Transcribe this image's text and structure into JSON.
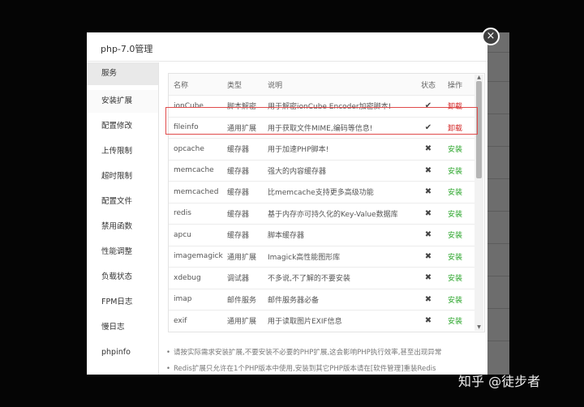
{
  "modal": {
    "title": "php-7.0管理",
    "close_glyph": "×"
  },
  "sidebar": {
    "items": [
      {
        "label": "服务"
      },
      {
        "label": "安装扩展"
      },
      {
        "label": "配置修改"
      },
      {
        "label": "上传限制"
      },
      {
        "label": "超时限制"
      },
      {
        "label": "配置文件"
      },
      {
        "label": "禁用函数"
      },
      {
        "label": "性能调整"
      },
      {
        "label": "负载状态"
      },
      {
        "label": "FPM日志"
      },
      {
        "label": "慢日志"
      },
      {
        "label": "phpinfo"
      }
    ]
  },
  "table": {
    "headers": [
      "名称",
      "类型",
      "说明",
      "状态",
      "操作"
    ],
    "rows": [
      {
        "name": "ionCube",
        "type": "脚本解密",
        "desc": "用于解密ionCube Encoder加密脚本!",
        "status": "✔",
        "op": "卸载",
        "installed": true
      },
      {
        "name": "fileinfo",
        "type": "通用扩展",
        "desc": "用于获取文件MIME,编码等信息!",
        "status": "✔",
        "op": "卸载",
        "installed": true
      },
      {
        "name": "opcache",
        "type": "缓存器",
        "desc": "用于加速PHP脚本!",
        "status": "✖",
        "op": "安装",
        "installed": false
      },
      {
        "name": "memcache",
        "type": "缓存器",
        "desc": "强大的内容缓存器",
        "status": "✖",
        "op": "安装",
        "installed": false
      },
      {
        "name": "memcached",
        "type": "缓存器",
        "desc": "比memcache支持更多高级功能",
        "status": "✖",
        "op": "安装",
        "installed": false
      },
      {
        "name": "redis",
        "type": "缓存器",
        "desc": "基于内存亦可持久化的Key-Value数据库",
        "status": "✖",
        "op": "安装",
        "installed": false
      },
      {
        "name": "apcu",
        "type": "缓存器",
        "desc": "脚本缓存器",
        "status": "✖",
        "op": "安装",
        "installed": false
      },
      {
        "name": "imagemagick",
        "type": "通用扩展",
        "desc": "Imagick高性能图形库",
        "status": "✖",
        "op": "安装",
        "installed": false
      },
      {
        "name": "xdebug",
        "type": "调试器",
        "desc": "不多说,不了解的不要安装",
        "status": "✖",
        "op": "安装",
        "installed": false
      },
      {
        "name": "imap",
        "type": "邮件服务",
        "desc": "邮件服务器必备",
        "status": "✖",
        "op": "安装",
        "installed": false
      },
      {
        "name": "exif",
        "type": "通用扩展",
        "desc": "用于读取图片EXIF信息",
        "status": "✖",
        "op": "安装",
        "installed": false
      }
    ]
  },
  "notes": [
    "请按实际需求安装扩展,不要安装不必要的PHP扩展,这会影响PHP执行效率,甚至出现异常",
    "Redis扩展只允许在1个PHP版本中使用,安装到其它PHP版本请在[软件管理]重装Redis"
  ],
  "watermark": "知乎 @徒步者",
  "colors": {
    "install": "#2aa52a",
    "uninstall": "#d22222",
    "highlight": "#e04b4b"
  }
}
